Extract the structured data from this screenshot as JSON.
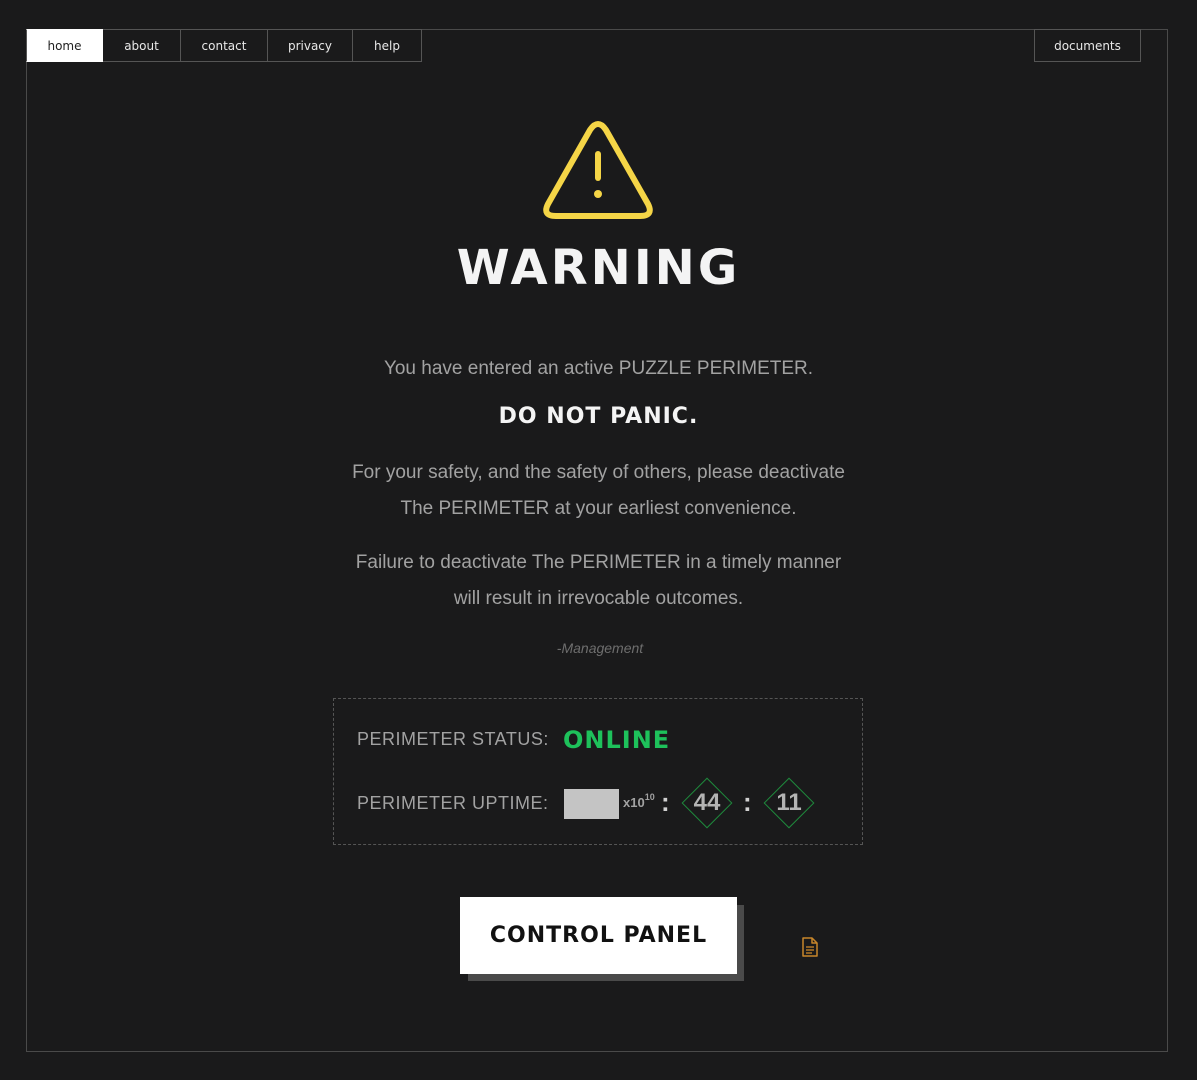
{
  "nav": {
    "tabs": [
      {
        "label": "home",
        "active": true
      },
      {
        "label": "about",
        "active": false
      },
      {
        "label": "contact",
        "active": false
      },
      {
        "label": "privacy",
        "active": false
      },
      {
        "label": "help",
        "active": false
      }
    ],
    "documents_label": "documents"
  },
  "main": {
    "icon": "warning-triangle-icon",
    "title": "WARNING",
    "intro": "You have entered an active PUZZLE PERIMETER.",
    "panic": "DO NOT PANIC.",
    "safety_line1": "For your safety, and the safety of others, please deactivate",
    "safety_line2": "The PERIMETER at your earliest convenience.",
    "failure_line1": "Failure to deactivate The PERIMETER in a timely manner",
    "failure_line2": "will result in irrevocable outcomes.",
    "signature": "-Management"
  },
  "status": {
    "status_label": "PERIMETER STATUS:",
    "status_value": "ONLINE",
    "uptime_label": "PERIMETER UPTIME:",
    "uptime_multiplier": "x10",
    "uptime_exponent": "10",
    "separator": ":",
    "minutes": "44",
    "seconds": "11"
  },
  "control_panel_label": "CONTROL PANEL",
  "doc_icon": "document-icon",
  "colors": {
    "background": "#1a1a1b",
    "warning_yellow": "#f5d547",
    "online_green": "#1ec15b",
    "diamond_green": "#1e8a3c",
    "doc_icon_orange": "#c8862a"
  }
}
